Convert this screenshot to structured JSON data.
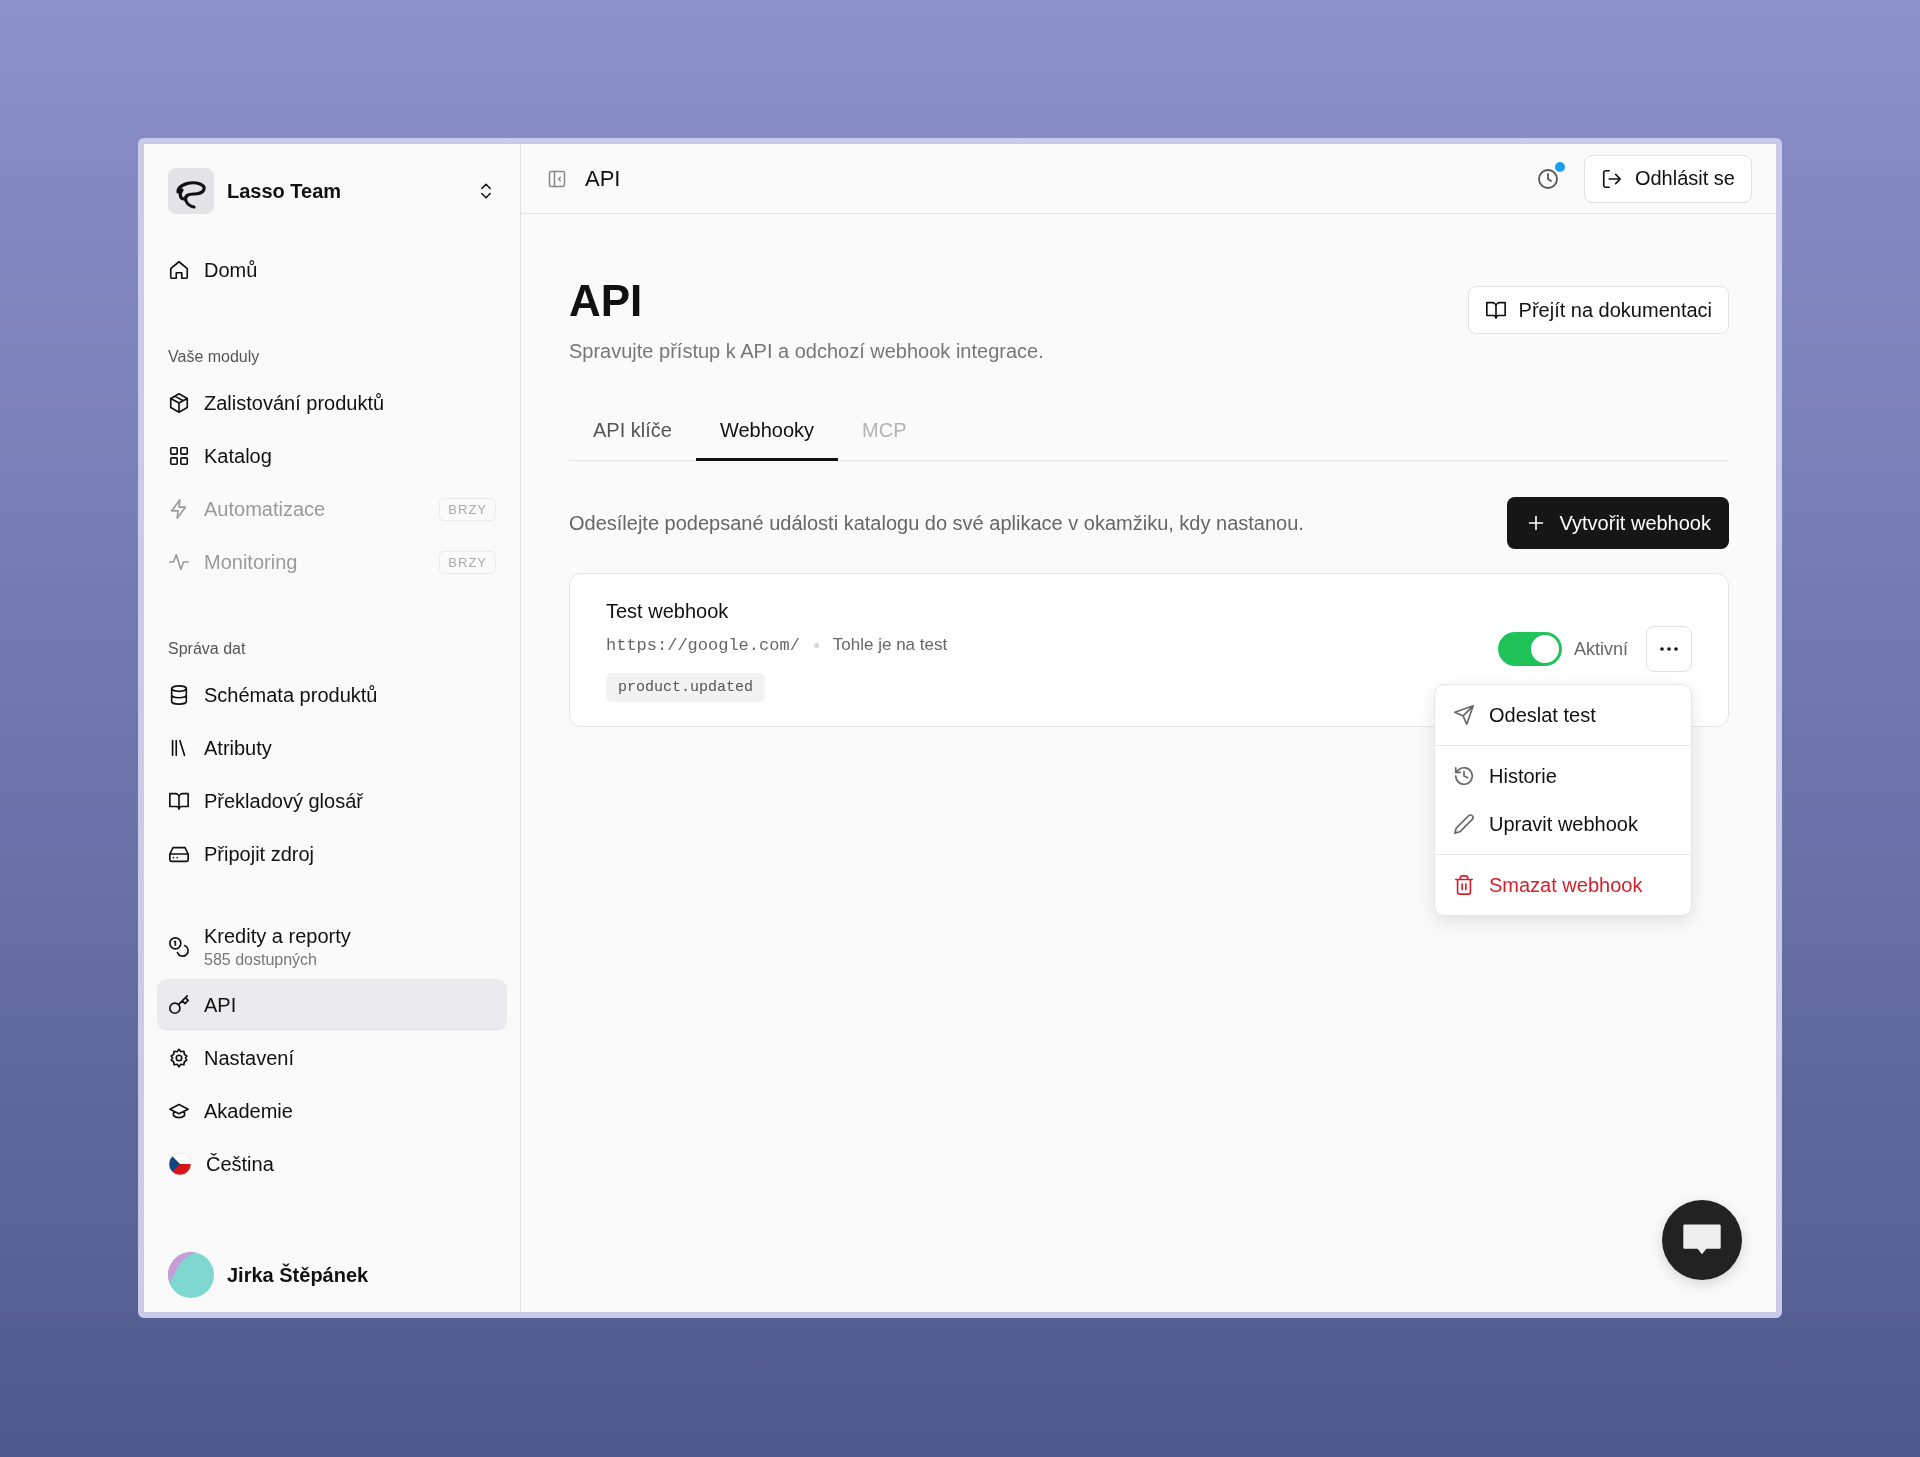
{
  "team": {
    "name": "Lasso Team"
  },
  "nav_groups": [
    {
      "items": [
        {
          "kind": "item",
          "label": "Domů",
          "selected": false,
          "disabled": false
        }
      ]
    },
    {
      "heading": "Vaše moduly",
      "items": [
        {
          "kind": "item",
          "label": "Zalistování produktů",
          "selected": false,
          "disabled": false
        },
        {
          "kind": "item",
          "label": "Katalog",
          "selected": false,
          "disabled": false
        },
        {
          "kind": "item",
          "label": "Automatizace",
          "selected": false,
          "disabled": true,
          "badge": "BRZY"
        },
        {
          "kind": "item",
          "label": "Monitoring",
          "selected": false,
          "disabled": true,
          "badge": "BRZY"
        }
      ]
    },
    {
      "heading": "Správa dat",
      "items": [
        {
          "kind": "item",
          "label": "Schémata produktů",
          "selected": false,
          "disabled": false
        },
        {
          "kind": "item",
          "label": "Atributy",
          "selected": false,
          "disabled": false
        },
        {
          "kind": "item",
          "label": "Překladový glosář",
          "selected": false,
          "disabled": false
        },
        {
          "kind": "item",
          "label": "Připojit zdroj",
          "selected": false,
          "disabled": false
        }
      ]
    },
    {
      "items": [
        {
          "kind": "credits",
          "label": "Kredity a reporty",
          "sub": "585 dostupných",
          "selected": false,
          "disabled": false
        },
        {
          "kind": "item",
          "label": "API",
          "selected": true,
          "disabled": false
        },
        {
          "kind": "item",
          "label": "Nastavení",
          "selected": false,
          "disabled": false
        },
        {
          "kind": "item",
          "label": "Akademie",
          "selected": false,
          "disabled": false
        },
        {
          "kind": "language",
          "label": "Čeština",
          "selected": false,
          "disabled": false
        }
      ]
    }
  ],
  "user": {
    "name": "Jirka Štěpánek"
  },
  "header": {
    "title": "API",
    "notification": true,
    "logout": "Odhlásit se"
  },
  "page": {
    "title": "API",
    "subtitle": "Spravujte přístup k API a odchozí webhook integrace.",
    "docs_button": "Přejít na dokumentaci"
  },
  "tabs": [
    {
      "label": "API klíče",
      "selected": false,
      "disabled": false
    },
    {
      "label": "Webhooky",
      "selected": true,
      "disabled": false
    },
    {
      "label": "MCP",
      "selected": false,
      "disabled": true
    }
  ],
  "webhooks_intro": "Odesílejte podepsané události katalogu do své aplikace v okamžiku, kdy nastanou.",
  "create_button": "Vytvořit webhook",
  "webhooks": [
    {
      "name": "Test webhook",
      "url": "https://google.com/",
      "note": "Tohle je na test",
      "events": [
        "product.updated"
      ],
      "active": true,
      "status": "Aktivní"
    }
  ],
  "menu": {
    "groups": [
      {
        "items": [
          {
            "label": "Odeslat test",
            "danger": false
          }
        ]
      },
      {
        "items": [
          {
            "label": "Historie",
            "danger": false
          },
          {
            "label": "Upravit webhook",
            "danger": false
          }
        ]
      },
      {
        "items": [
          {
            "label": "Smazat webhook",
            "danger": true
          }
        ]
      }
    ]
  }
}
